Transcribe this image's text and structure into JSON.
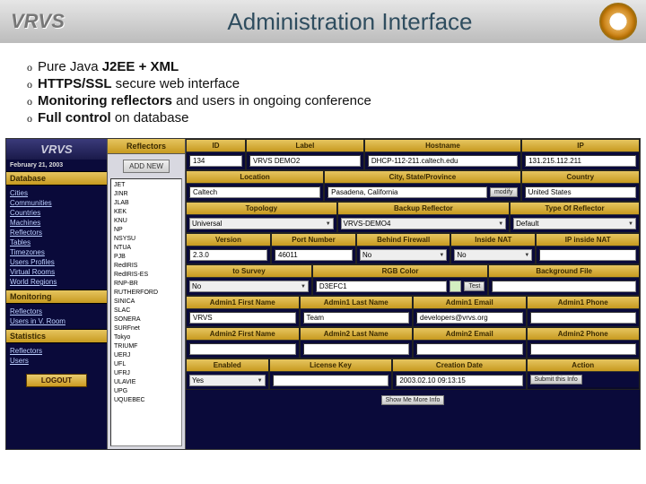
{
  "header": {
    "logo": "VRVS",
    "title": "Administration Interface"
  },
  "bullets": [
    {
      "o": "o",
      "prefix": "Pure Java ",
      "bold": "J2EE + XML",
      "suffix": ""
    },
    {
      "o": "o",
      "prefix": "",
      "bold": "HTTPS/SSL",
      "suffix": " secure web interface"
    },
    {
      "o": "o",
      "prefix": "",
      "bold": "Monitoring reflectors",
      "suffix": " and users in ongoing conference"
    },
    {
      "o": "o",
      "prefix": "",
      "bold": "Full control",
      "suffix": " on database"
    }
  ],
  "sidebar": {
    "logo": "VRVS",
    "date": "February 21, 2003",
    "sections": [
      {
        "title": "Database",
        "links": [
          "Cities",
          "Communities",
          "Countries",
          "Machines",
          "Reflectors",
          "Tables",
          "Timezones",
          "Users Profiles",
          "Virtual Rooms",
          "World Regions"
        ]
      },
      {
        "title": "Monitoring",
        "links": [
          "Reflectors",
          "Users in V. Room"
        ]
      },
      {
        "title": "Statistics",
        "links": [
          "Reflectors",
          "Users"
        ]
      }
    ],
    "logout": "LOGOUT"
  },
  "mid": {
    "title": "Reflectors",
    "addnew": "ADD NEW",
    "items": [
      "JET",
      "JINR",
      "JLAB",
      "KEK",
      "KNU",
      "NP",
      "NSYSU",
      "NTUA",
      "PJB",
      "RedIRIS",
      "RedIRIS-ES",
      "RNP-BR",
      "RUTHERFORD",
      "SINICA",
      "SLAC",
      "SONERA",
      "SURFnet",
      "Tokyo",
      "TRIUMF",
      "UERJ",
      "UFL",
      "UFRJ",
      "ULAVIE",
      "UPG",
      "UQUEBEC"
    ]
  },
  "form": {
    "r1": [
      {
        "label": "ID",
        "value": "134"
      },
      {
        "label": "Label",
        "value": "VRVS DEMO2"
      },
      {
        "label": "Hostname",
        "value": "DHCP-112-211.caltech.edu"
      },
      {
        "label": "IP",
        "value": "131.215.112.211"
      }
    ],
    "r2": [
      {
        "label": "Location",
        "value": "Caltech"
      },
      {
        "label": "City, State/Province",
        "value": "Pasadena, California",
        "btn": "modify"
      },
      {
        "label": "Country",
        "value": "United States"
      }
    ],
    "r3": [
      {
        "label": "Topology",
        "select": "Universal"
      },
      {
        "label": "Backup Reflector",
        "select": "VRVS-DEMO4"
      },
      {
        "label": "Type Of Reflector",
        "select": "Default"
      }
    ],
    "r4": [
      {
        "label": "Version",
        "value": "2.3.0"
      },
      {
        "label": "Port Number",
        "value": "46011"
      },
      {
        "label": "Behind Firewall",
        "select": "No"
      },
      {
        "label": "Inside NAT",
        "select": "No"
      },
      {
        "label": "IP inside NAT",
        "value": ""
      }
    ],
    "r5": [
      {
        "label": "to Survey",
        "select": "No"
      },
      {
        "label": "RGB Color",
        "value": "D3EFC1",
        "btn": "Test"
      },
      {
        "label": "Background File",
        "value": ""
      }
    ],
    "r6": [
      {
        "label": "Admin1 First Name",
        "value": "VRVS"
      },
      {
        "label": "Admin1 Last Name",
        "value": "Team"
      },
      {
        "label": "Admin1 Email",
        "value": "developers@vrvs.org"
      },
      {
        "label": "Admin1 Phone",
        "value": ""
      }
    ],
    "r7": [
      {
        "label": "Admin2 First Name",
        "value": ""
      },
      {
        "label": "Admin2 Last Name",
        "value": ""
      },
      {
        "label": "Admin2 Email",
        "value": ""
      },
      {
        "label": "Admin2 Phone",
        "value": ""
      }
    ],
    "r8": [
      {
        "label": "Enabled",
        "select": "Yes"
      },
      {
        "label": "License Key",
        "value": ""
      },
      {
        "label": "Creation Date",
        "value": "2003.02.10 09:13:15"
      },
      {
        "label": "Action",
        "btn": "Submit this Info"
      }
    ],
    "footer_btn": "Show Me More Info"
  }
}
